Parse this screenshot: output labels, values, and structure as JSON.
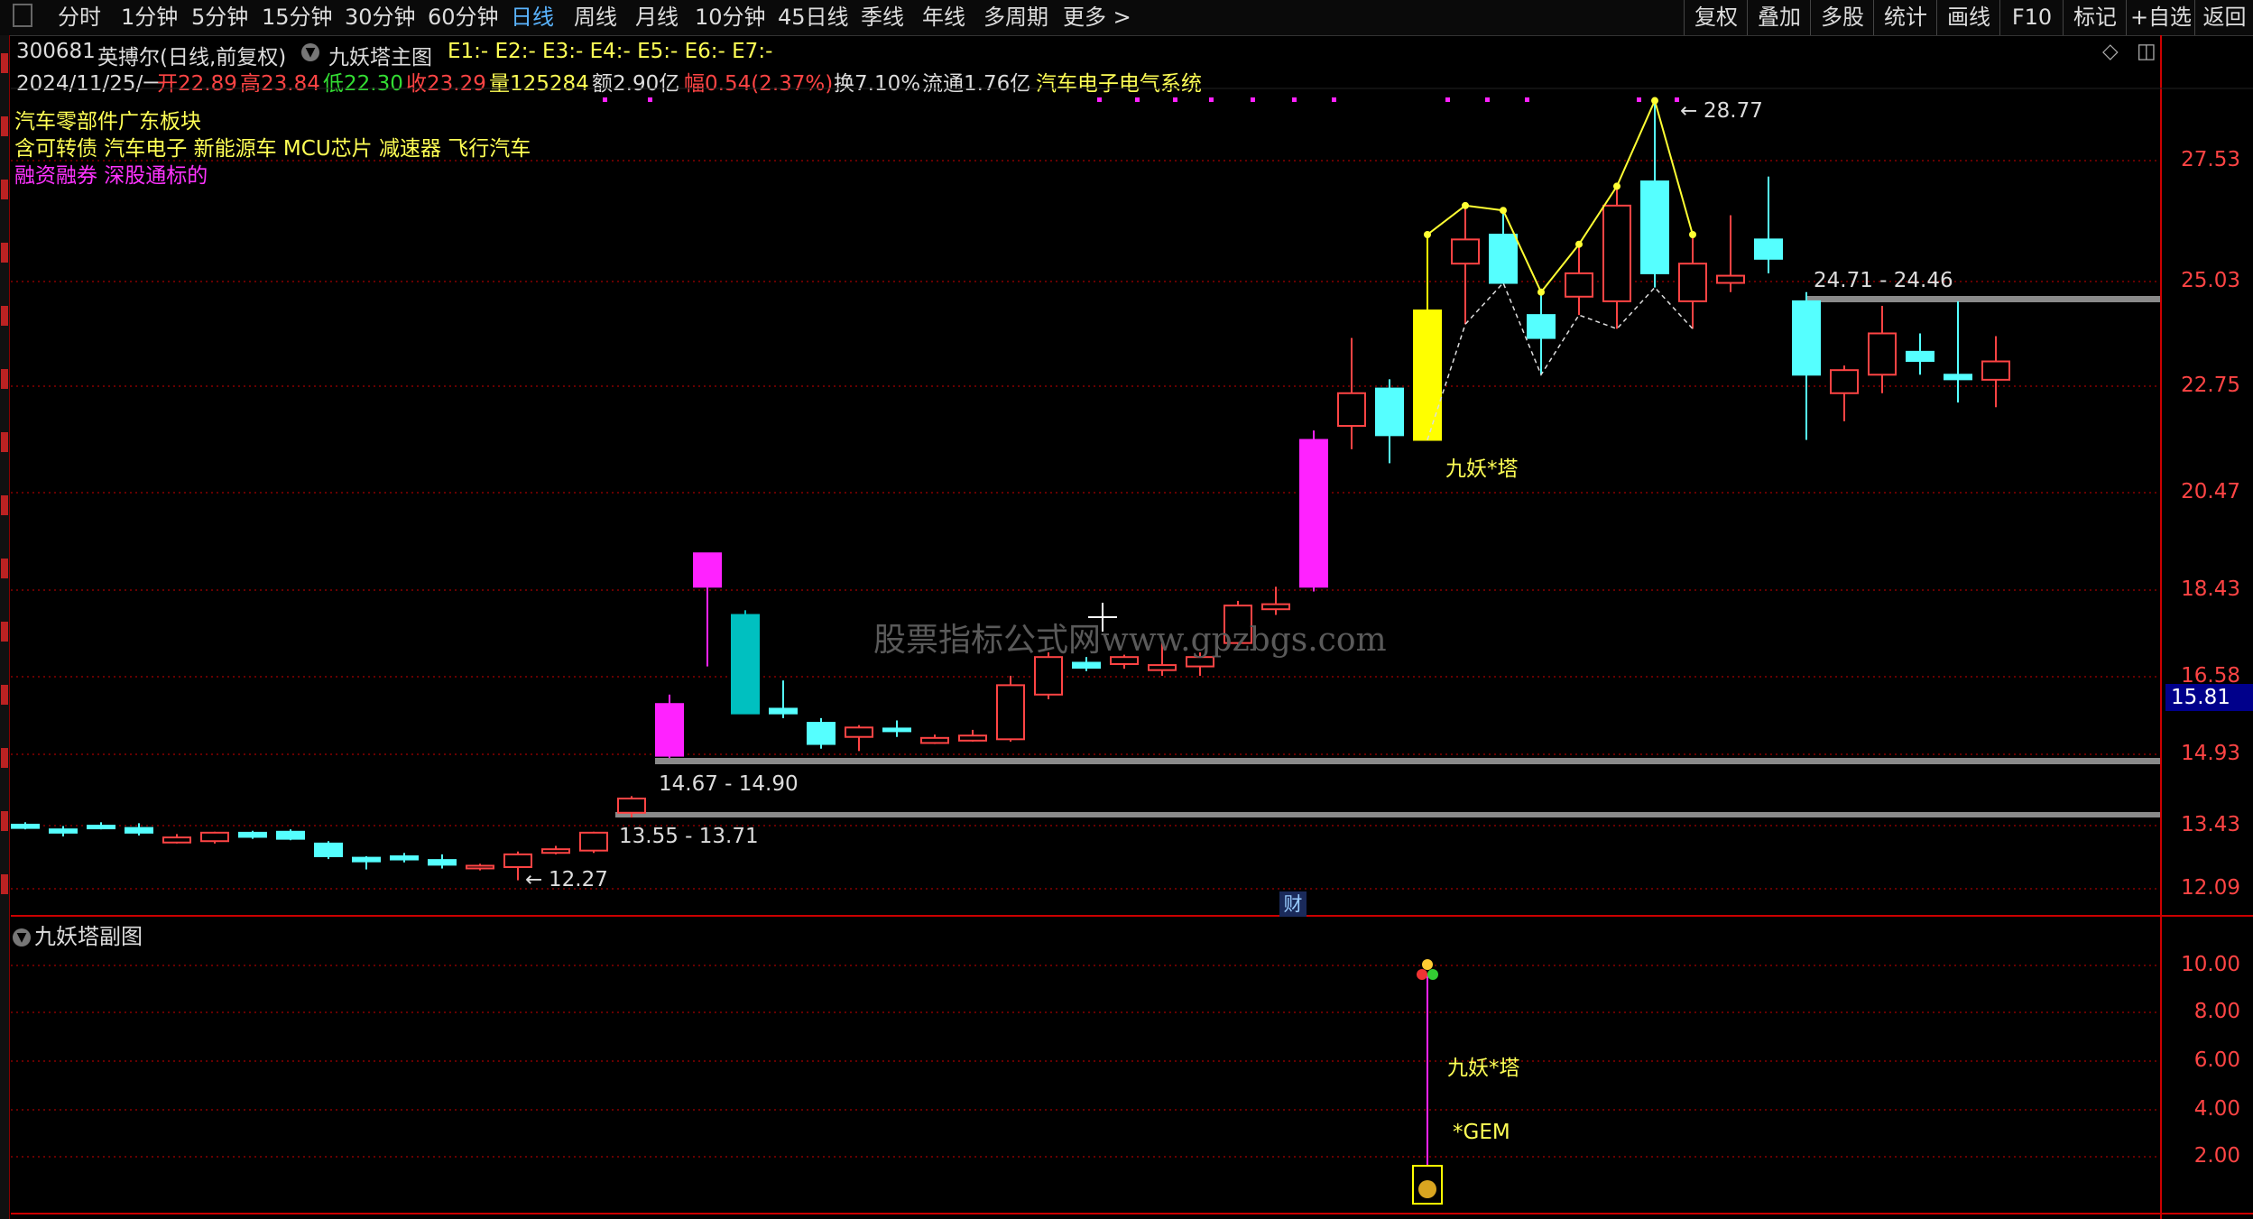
{
  "toolbar": {
    "periods": [
      "分时",
      "1分钟",
      "5分钟",
      "15分钟",
      "30分钟",
      "60分钟",
      "日线",
      "周线",
      "月线",
      "10分钟",
      "45日线",
      "季线",
      "年线",
      "多周期",
      "更多 >"
    ],
    "active_period": "日线",
    "right_buttons": [
      "复权",
      "叠加",
      "多股",
      "统计",
      "画线",
      "F10",
      "标记",
      "+自选",
      "返回"
    ]
  },
  "header": {
    "code": "300681",
    "name": "英搏尔(日线,前复权)",
    "indicator_name": "九妖塔主图",
    "indicator_values": "E1:-  E2:-  E3:-  E4:-  E5:-  E6:-  E7:-",
    "date": "2024/11/25/一",
    "open": "开22.89",
    "high": "高23.84",
    "low": "低22.30",
    "close": "收23.29",
    "volume": "量125284",
    "amount": "额2.90亿",
    "change": "幅0.54(2.37%)",
    "turnover": "换7.10%",
    "float_cap": "流通1.76亿",
    "sector": "汽车电子电气系统"
  },
  "tags": {
    "line1": "汽车零部件广东板块",
    "line2": "含可转债 汽车电子 新能源车 MCU芯片 减速器 飞行汽车",
    "line3": "融资融券 深股通标的"
  },
  "main_axis": {
    "labels": [
      "27.53",
      "25.03",
      "22.75",
      "20.47",
      "18.43",
      "16.58",
      "14.93",
      "13.43",
      "12.09"
    ],
    "current_price": "15.81"
  },
  "annotations": {
    "high_mark": "28.77",
    "low_mark": "12.27",
    "zone_upper": "24.71 - 24.46",
    "zone_mid": "14.67 - 14.90",
    "zone_low": "13.55 - 13.71",
    "signal_main": "九妖*塔",
    "finance_badge": "财",
    "watermark": "股票指标公式网www.gpzbgs.com"
  },
  "sub_chart": {
    "title": "九妖塔副图",
    "axis_labels": [
      "10.00",
      "8.00",
      "6.00",
      "4.00",
      "2.00"
    ],
    "signal_text": "九妖*塔",
    "gem_text": "*GEM"
  },
  "colors": {
    "up": "#ff4444",
    "down": "#55ffff",
    "magenta": "#ff22ff",
    "yellow": "#ffff00",
    "axis": "#cc0000"
  },
  "chart_data": {
    "type": "candlestick",
    "ylim": [
      12.09,
      28.77
    ],
    "candles": [
      {
        "o": 13.45,
        "h": 13.5,
        "l": 13.35,
        "c": 13.38,
        "dir": "down"
      },
      {
        "o": 13.35,
        "h": 13.42,
        "l": 13.2,
        "c": 13.28,
        "dir": "down"
      },
      {
        "o": 13.4,
        "h": 13.5,
        "l": 13.35,
        "c": 13.4,
        "dir": "down"
      },
      {
        "o": 13.38,
        "h": 13.48,
        "l": 13.22,
        "c": 13.28,
        "dir": "down"
      },
      {
        "o": 13.1,
        "h": 13.25,
        "l": 13.05,
        "c": 13.15,
        "dir": "up"
      },
      {
        "o": 13.1,
        "h": 13.3,
        "l": 13.05,
        "c": 13.28,
        "dir": "up"
      },
      {
        "o": 13.25,
        "h": 13.32,
        "l": 13.15,
        "c": 13.22,
        "dir": "down"
      },
      {
        "o": 13.3,
        "h": 13.35,
        "l": 13.12,
        "c": 13.15,
        "dir": "down"
      },
      {
        "o": 13.05,
        "h": 13.1,
        "l": 12.72,
        "c": 12.78,
        "dir": "down"
      },
      {
        "o": 12.72,
        "h": 12.78,
        "l": 12.5,
        "c": 12.7,
        "dir": "down"
      },
      {
        "o": 12.75,
        "h": 12.85,
        "l": 12.65,
        "c": 12.74,
        "dir": "down"
      },
      {
        "o": 12.7,
        "h": 12.82,
        "l": 12.52,
        "c": 12.6,
        "dir": "down"
      },
      {
        "o": 12.55,
        "h": 12.62,
        "l": 12.48,
        "c": 12.55,
        "dir": "up"
      },
      {
        "o": 12.55,
        "h": 12.88,
        "l": 12.27,
        "c": 12.82,
        "dir": "up"
      },
      {
        "o": 12.88,
        "h": 13.0,
        "l": 12.82,
        "c": 12.9,
        "dir": "up"
      },
      {
        "o": 12.9,
        "h": 13.3,
        "l": 12.85,
        "c": 13.28,
        "dir": "up"
      },
      {
        "o": 13.7,
        "h": 14.05,
        "l": 13.6,
        "c": 14.0,
        "dir": "up"
      },
      {
        "o": 14.9,
        "h": 16.2,
        "l": 14.85,
        "c": 16.0,
        "dir": "up_magenta"
      },
      {
        "o": 18.5,
        "h": 19.0,
        "l": 16.8,
        "c": 19.2,
        "dir": "up_magenta"
      },
      {
        "o": 17.9,
        "h": 18.0,
        "l": 15.8,
        "c": 15.8,
        "dir": "down_teal"
      },
      {
        "o": 15.9,
        "h": 16.5,
        "l": 15.7,
        "c": 15.8,
        "dir": "down"
      },
      {
        "o": 15.6,
        "h": 15.7,
        "l": 15.05,
        "c": 15.15,
        "dir": "down"
      },
      {
        "o": 15.3,
        "h": 15.55,
        "l": 15.0,
        "c": 15.5,
        "dir": "up"
      },
      {
        "o": 15.45,
        "h": 15.65,
        "l": 15.3,
        "c": 15.45,
        "dir": "down"
      },
      {
        "o": 15.2,
        "h": 15.35,
        "l": 15.15,
        "c": 15.25,
        "dir": "up"
      },
      {
        "o": 15.25,
        "h": 15.45,
        "l": 15.2,
        "c": 15.3,
        "dir": "up"
      },
      {
        "o": 15.25,
        "h": 16.6,
        "l": 15.2,
        "c": 16.4,
        "dir": "up"
      },
      {
        "o": 16.2,
        "h": 17.1,
        "l": 16.1,
        "c": 17.0,
        "dir": "up"
      },
      {
        "o": 16.8,
        "h": 17.0,
        "l": 16.7,
        "c": 16.85,
        "dir": "down"
      },
      {
        "o": 16.85,
        "h": 17.05,
        "l": 16.75,
        "c": 17.0,
        "dir": "up"
      },
      {
        "o": 16.75,
        "h": 17.3,
        "l": 16.6,
        "c": 16.8,
        "dir": "up"
      },
      {
        "o": 16.8,
        "h": 17.1,
        "l": 16.6,
        "c": 17.0,
        "dir": "up"
      },
      {
        "o": 17.3,
        "h": 18.2,
        "l": 17.25,
        "c": 18.1,
        "dir": "up"
      },
      {
        "o": 18.05,
        "h": 18.5,
        "l": 17.9,
        "c": 18.1,
        "dir": "up"
      },
      {
        "o": 18.5,
        "h": 21.8,
        "l": 18.4,
        "c": 21.6,
        "dir": "up_magenta"
      },
      {
        "o": 21.9,
        "h": 23.8,
        "l": 21.4,
        "c": 22.6,
        "dir": "up"
      },
      {
        "o": 22.7,
        "h": 22.9,
        "l": 21.1,
        "c": 21.7,
        "dir": "down"
      },
      {
        "o": 21.6,
        "h": 26.0,
        "l": 21.6,
        "c": 24.4,
        "dir": "yellow"
      },
      {
        "o": 25.4,
        "h": 26.6,
        "l": 24.1,
        "c": 25.9,
        "dir": "up"
      },
      {
        "o": 26.0,
        "h": 26.5,
        "l": 25.0,
        "c": 25.0,
        "dir": "down"
      },
      {
        "o": 24.3,
        "h": 24.8,
        "l": 23.0,
        "c": 23.8,
        "dir": "down"
      },
      {
        "o": 24.7,
        "h": 25.8,
        "l": 24.3,
        "c": 25.2,
        "dir": "up"
      },
      {
        "o": 24.6,
        "h": 27.0,
        "l": 24.0,
        "c": 26.6,
        "dir": "up"
      },
      {
        "o": 27.1,
        "h": 28.77,
        "l": 24.9,
        "c": 25.2,
        "dir": "down"
      },
      {
        "o": 24.6,
        "h": 26.0,
        "l": 24.0,
        "c": 25.4,
        "dir": "up"
      },
      {
        "o": 25.0,
        "h": 26.4,
        "l": 24.8,
        "c": 25.15,
        "dir": "up"
      },
      {
        "o": 25.9,
        "h": 27.2,
        "l": 25.2,
        "c": 25.5,
        "dir": "down"
      },
      {
        "o": 24.6,
        "h": 24.8,
        "l": 21.6,
        "c": 23.0,
        "dir": "down"
      },
      {
        "o": 22.6,
        "h": 23.2,
        "l": 22.0,
        "c": 23.1,
        "dir": "up"
      },
      {
        "o": 23.0,
        "h": 24.5,
        "l": 22.6,
        "c": 23.9,
        "dir": "up"
      },
      {
        "o": 23.5,
        "h": 23.9,
        "l": 23.0,
        "c": 23.3,
        "dir": "down"
      },
      {
        "o": 23.0,
        "h": 24.6,
        "l": 22.4,
        "c": 22.9,
        "dir": "down"
      },
      {
        "o": 22.89,
        "h": 23.84,
        "l": 22.3,
        "c": 23.29,
        "dir": "up"
      }
    ]
  }
}
